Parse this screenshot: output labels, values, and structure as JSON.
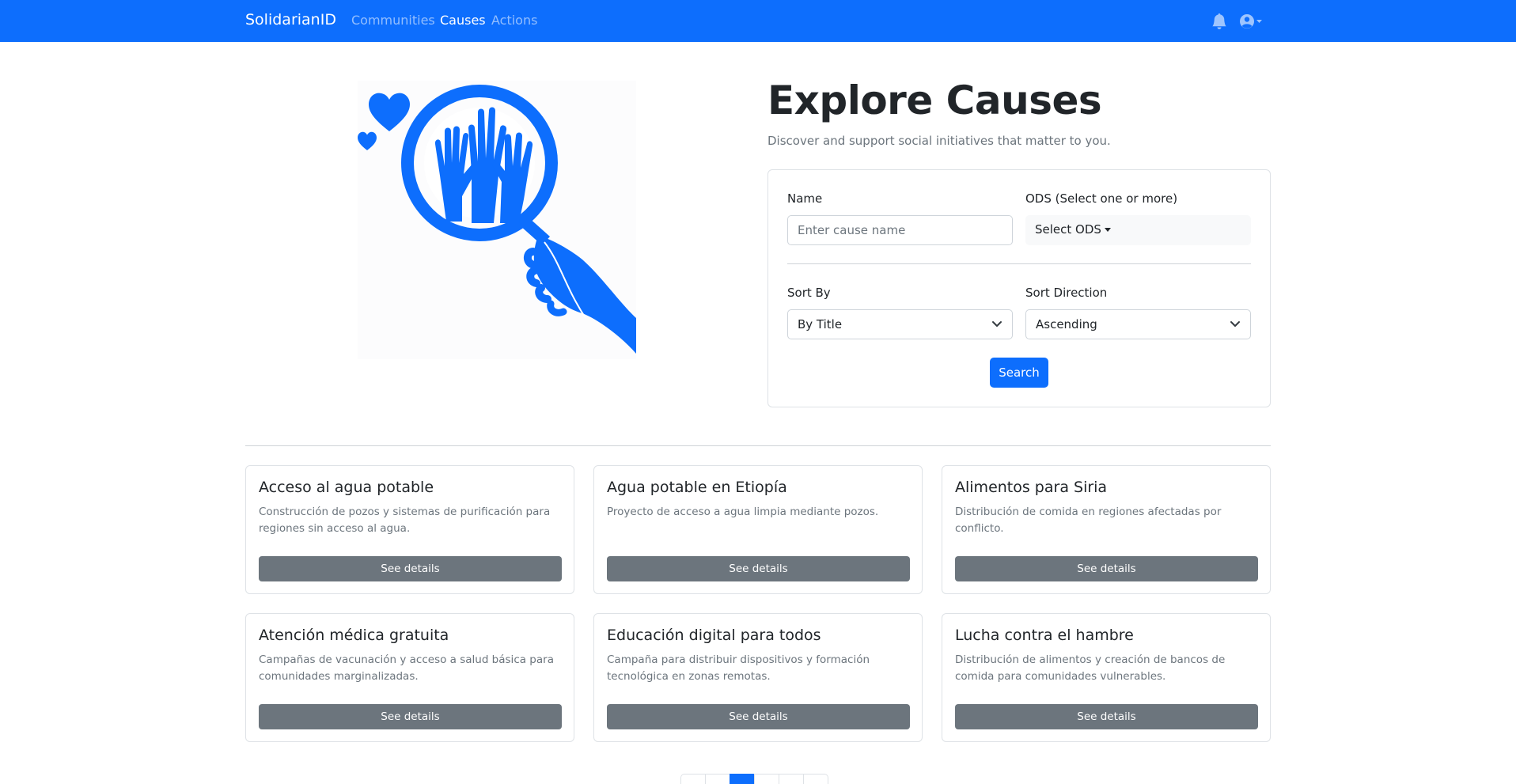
{
  "navbar": {
    "brand": "SolidarianID",
    "links": [
      {
        "label": "Communities",
        "active": false
      },
      {
        "label": "Causes",
        "active": true
      },
      {
        "label": "Actions",
        "active": false
      }
    ],
    "icons": [
      "bell-icon",
      "user-circle-icon"
    ]
  },
  "hero": {
    "image_icon": "magnifier-hands-hearts-illustration",
    "title": "Explore Causes",
    "subtitle": "Discover and support social initiatives that matter to you."
  },
  "filters": {
    "name_label": "Name",
    "name_placeholder": "Enter cause name",
    "name_value": "",
    "ods_label": "ODS (Select one or more)",
    "ods_button": "Select ODS",
    "sort_by_label": "Sort By",
    "sort_by_value": "By Title",
    "sort_direction_label": "Sort Direction",
    "sort_direction_value": "Ascending",
    "search_button": "Search"
  },
  "causes": [
    {
      "title": "Acceso al agua potable",
      "description": "Construcción de pozos y sistemas de purificación para regiones sin acceso al agua.",
      "button": "See details"
    },
    {
      "title": "Agua potable en Etiopía",
      "description": "Proyecto de acceso a agua limpia mediante pozos.",
      "button": "See details"
    },
    {
      "title": "Alimentos para Siria",
      "description": "Distribución de comida en regiones afectadas por conflicto.",
      "button": "See details"
    },
    {
      "title": "Atención médica gratuita",
      "description": "Campañas de vacunación y acceso a salud básica para comunidades marginalizadas.",
      "button": "See details"
    },
    {
      "title": "Educación digital para todos",
      "description": "Campaña para distribuir dispositivos y formación tecnológica en zonas remotas.",
      "button": "See details"
    },
    {
      "title": "Lucha contra el hambre",
      "description": "Distribución de alimentos y creación de bancos de comida para comunidades vulnerables.",
      "button": "See details"
    }
  ],
  "pagination": {
    "active_index": 2
  },
  "colors": {
    "primary": "#0d6efd",
    "secondary": "#6c757d",
    "text": "#212529"
  }
}
